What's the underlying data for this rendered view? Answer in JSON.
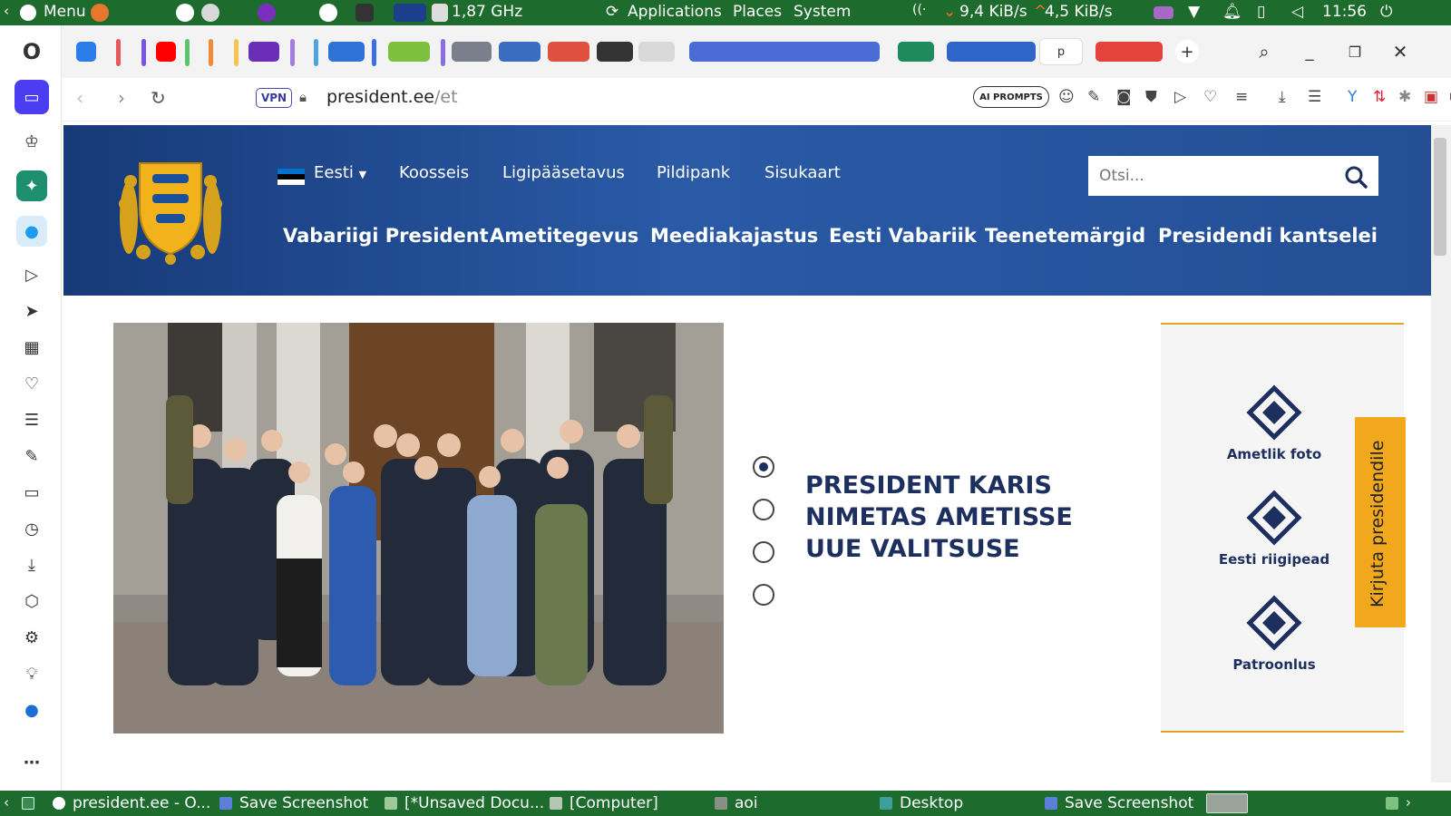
{
  "system_bar": {
    "menu_label": "Menu",
    "cpu_freq": "1,87 GHz",
    "applications": "Applications",
    "places": "Places",
    "system": "System",
    "net_down": "9,4 KiB/s",
    "net_up": "4,5 KiB/s",
    "clock": "11:56"
  },
  "browser": {
    "vpn_label": "VPN",
    "url_host": "president.ee",
    "url_path": "/et",
    "ai_prompts_label": "AI PROMPTS"
  },
  "site": {
    "language": "Eesti",
    "top_nav": [
      "Koosseis",
      "Ligipääsetavus",
      "Pildipank",
      "Sisukaart"
    ],
    "search_placeholder": "Otsi...",
    "main_nav": [
      "Vabariigi President",
      "Ametitegevus",
      "Meediakajastus",
      "Eesti Vabariik",
      "Teenetemärgid",
      "Presidendi kantselei"
    ],
    "headline": "PRESIDENT KARIS NIMETAS AMETISSE UUE VALITSUSE",
    "slider_active_index": 0,
    "slider_dot_count": 4,
    "right_panel": [
      "Ametlik foto",
      "Eesti riigipead",
      "Patroonlus"
    ],
    "write_button": "Kirjuta presidendile",
    "colors": {
      "header_blue": "#234c90",
      "accent_gold": "#f2a81d",
      "text_navy": "#1c2f5e"
    }
  },
  "taskbar": {
    "items": [
      "president.ee - O...",
      "Save Screenshot",
      "[*Unsaved Docu...",
      "[Computer]",
      "aoi",
      "Desktop",
      "Save Screenshot"
    ]
  }
}
